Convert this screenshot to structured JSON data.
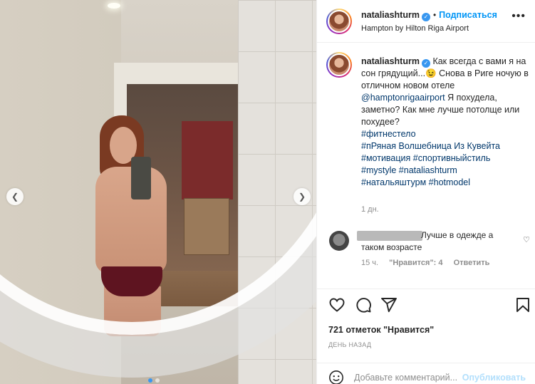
{
  "post": {
    "username": "nataliashturm",
    "follow_label": "Подписаться",
    "separator": "•",
    "location": "Hampton by Hilton Riga Airport",
    "verified_glyph": "✓"
  },
  "caption": {
    "username": "nataliashturm",
    "text_before_mention": "Как всегда с вами я на сон грядущий...😉 Снова в Риге ночую в отличном новом отеле",
    "mention": "@hamptonrigaairport",
    "text_after_mention": "Я похудела, заметно? Как мне лучше потолще или похудее?",
    "hashtags": [
      "#фитнестело",
      "#пРяная Волшебница Из Кувейта",
      "#мотивация #спортивныйстиль",
      "#mystyle #nataliashturm",
      "#натальяштурм #hotmodel"
    ],
    "time": "1 дн."
  },
  "comment": {
    "text": "Лучше в одежде а таком возрасте",
    "time": "15 ч.",
    "likes": "\"Нравится\": 4",
    "reply": "Ответить"
  },
  "actions": {
    "likes_count": "721 отметок \"Нравится\"",
    "date": "ДЕНЬ НАЗАД",
    "comment_placeholder": "Добавьте комментарий...",
    "publish_label": "Опубликовать"
  },
  "icons": {
    "more": "more-icon",
    "like": "heart-icon",
    "comment": "comment-icon",
    "share": "share-icon",
    "save": "bookmark-icon",
    "emoji": "emoji-icon",
    "prev": "chevron-left-icon",
    "next": "chevron-right-icon"
  },
  "colors": {
    "link": "#00376b",
    "follow": "#0095f6",
    "verified": "#3897f0",
    "muted": "#8e8e8e",
    "publish_disabled": "#b2dffc"
  }
}
